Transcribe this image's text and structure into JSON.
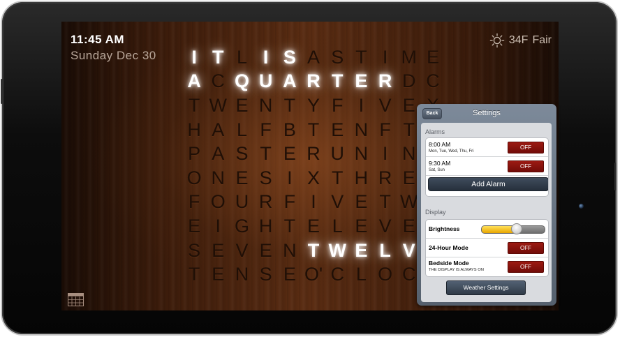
{
  "clock": {
    "time": "11:45 AM",
    "date": "Sunday Dec 30",
    "weather": {
      "temp": "34F",
      "condition": "Fair",
      "icon": "sun-icon"
    }
  },
  "word_grid": {
    "rows": [
      "ITLISASTIME",
      "ACQUARTERDC",
      "TWENTYFIVEX",
      "HALFBTENFTO",
      "PASTERUNINE",
      "ONESIXTHREE",
      "FOURFIVETWO",
      "EIGHTELEVEN",
      "SEVENTWELVE",
      "TENSEO'CLOCK"
    ],
    "lit": [
      [
        0,
        0
      ],
      [
        0,
        1
      ],
      [
        0,
        3
      ],
      [
        0,
        4
      ],
      [
        1,
        0
      ],
      [
        1,
        2
      ],
      [
        1,
        3
      ],
      [
        1,
        4
      ],
      [
        1,
        5
      ],
      [
        1,
        6
      ],
      [
        1,
        7
      ],
      [
        1,
        8
      ],
      [
        3,
        10
      ],
      [
        8,
        5
      ],
      [
        8,
        6
      ],
      [
        8,
        7
      ],
      [
        8,
        8
      ],
      [
        8,
        9
      ],
      [
        8,
        10
      ]
    ]
  },
  "settings": {
    "title": "Settings",
    "back_label": "Back",
    "alarms_label": "Alarms",
    "alarms": [
      {
        "time": "8:00 AM",
        "days": "Mon, Tue, Wed, Thu, Fri",
        "state": "OFF"
      },
      {
        "time": "9:30 AM",
        "days": "Sat, Sun",
        "state": "OFF"
      }
    ],
    "add_alarm_label": "Add Alarm",
    "display_label": "Display",
    "brightness_label": "Brightness",
    "brightness_level": 0.55,
    "hour24_label": "24-Hour Mode",
    "hour24_state": "OFF",
    "bedside_label": "Bedside Mode",
    "bedside_sub": "THE DISPLAY IS ALWAYS ON",
    "bedside_state": "OFF",
    "weather_settings_label": "Weather Settings"
  },
  "colors": {
    "wood_dark": "#1a0c05",
    "wood_mid": "#5a2c12",
    "lit_letter": "#ffffff",
    "dim_letter": "#1f0f06",
    "off_red": "#9c1a12",
    "slider_yellow": "#f2c21a"
  }
}
